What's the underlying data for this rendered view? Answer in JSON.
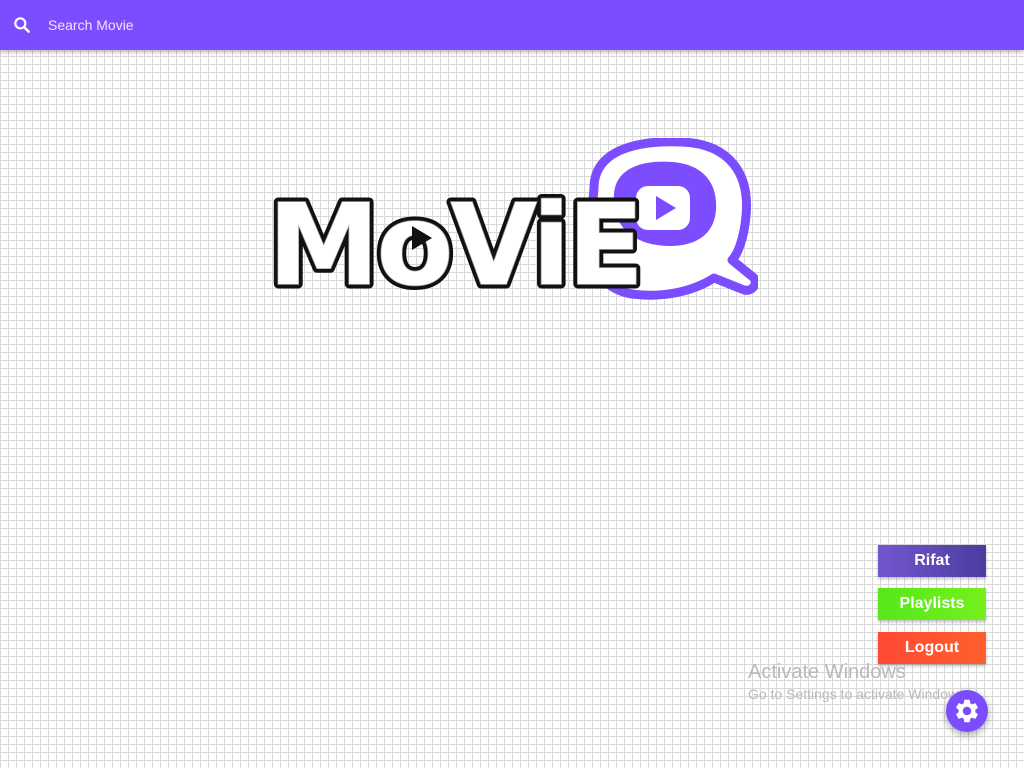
{
  "header": {
    "search_placeholder": "Search Movie",
    "search_icon": "search-icon",
    "background_color": "#7c4dff"
  },
  "logo": {
    "text": "MoViE",
    "emblem": "play-icon",
    "accent_color": "#7c4dff"
  },
  "menu": {
    "user_label": "Rifat",
    "playlists_label": "Playlists",
    "logout_label": "Logout"
  },
  "watermark": {
    "title": "Activate Windows",
    "subtitle": "Go to Settings to activate Windows."
  },
  "fab": {
    "icon": "gear-icon"
  }
}
